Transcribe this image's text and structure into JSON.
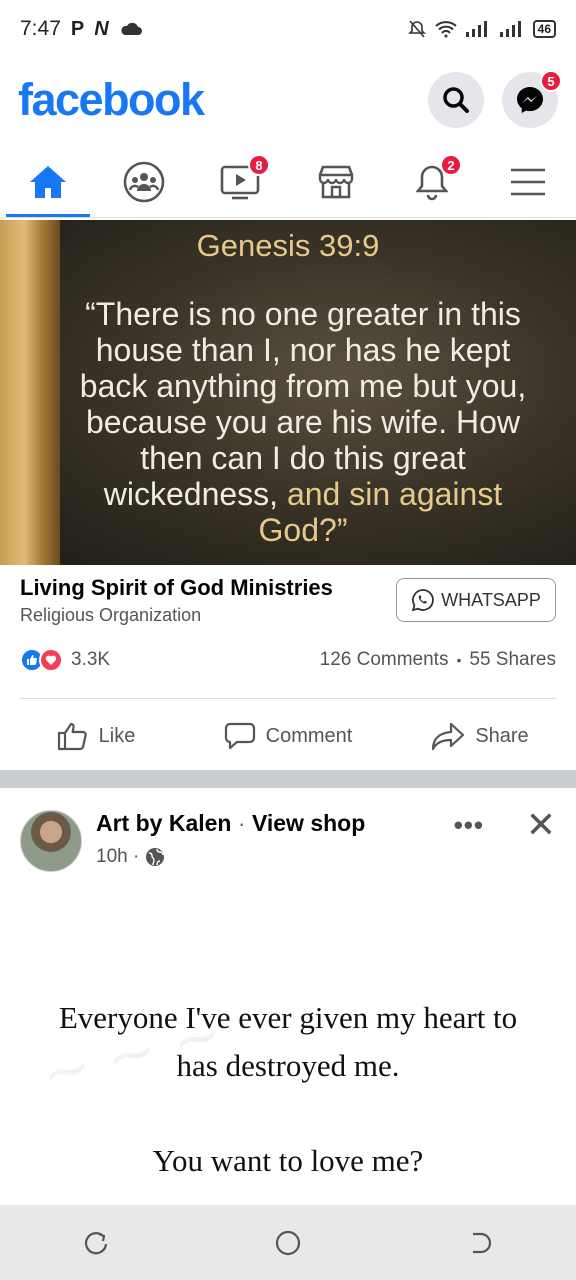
{
  "status_bar": {
    "time": "7:47",
    "glyphs": [
      "P",
      "N"
    ],
    "battery": "46"
  },
  "header": {
    "logo": "facebook",
    "messenger_badge": "5"
  },
  "nav": {
    "tabs": [
      {
        "name": "home",
        "active": true
      },
      {
        "name": "groups"
      },
      {
        "name": "watch",
        "badge": "8"
      },
      {
        "name": "marketplace"
      },
      {
        "name": "notifications",
        "badge": "2"
      },
      {
        "name": "menu"
      }
    ]
  },
  "post1": {
    "image": {
      "reference": "Genesis 39:9",
      "quote_lines": [
        "“There is no one greater in this",
        "house than I, nor has he kept",
        "back anything from me but you,",
        "because you are his wife. How",
        "then can I do this great"
      ],
      "quote_tail_white": "wickedness, ",
      "quote_tail_gold": "and sin against",
      "quote_last": "God?”"
    },
    "page_name": "Living Spirit of God Ministries",
    "category": "Religious Organization",
    "whatsapp_label": "WHATSAPP",
    "reactions_count": "3.3K",
    "comments": "126 Comments",
    "shares": "55 Shares",
    "stats_sep": "•",
    "actions": {
      "like": "Like",
      "comment": "Comment",
      "share": "Share"
    }
  },
  "post2": {
    "author": "Art by Kalen",
    "dot": "·",
    "view_shop": "View shop",
    "time": "10h ·",
    "more": "•••",
    "close": "✕",
    "lines": [
      "Everyone I've ever given my heart to",
      "has destroyed me.",
      "You want to love me?"
    ]
  },
  "colors": {
    "brand": "#1877f2",
    "badge": "#e41e3f",
    "gold_text": "#e7c98a"
  }
}
